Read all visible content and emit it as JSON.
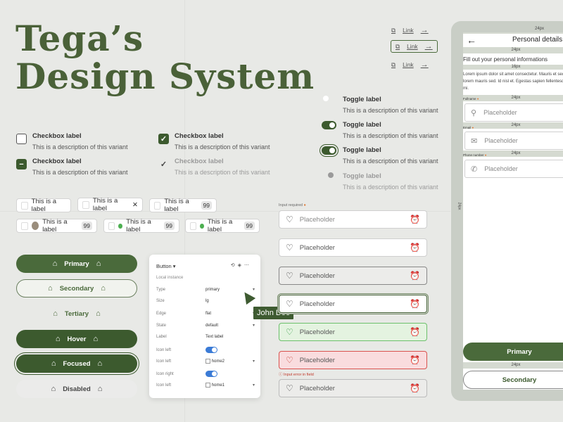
{
  "title": {
    "line1": "Tega’s",
    "line2": "Design System"
  },
  "checkboxes": [
    {
      "label": "Checkbox label",
      "desc": "This is a description of this variant",
      "state": "unchecked"
    },
    {
      "label": "Checkbox label",
      "desc": "This is a description of this variant",
      "state": "checked"
    },
    {
      "label": "Checkbox label",
      "desc": "This is a description of this variant",
      "state": "indeterminate"
    },
    {
      "label": "Checkbox label",
      "desc": "This is a description of this variant",
      "state": "disabled-check"
    }
  ],
  "chips": {
    "row1": [
      {
        "label": "This is a label"
      },
      {
        "label": "This is a label",
        "close": "✕"
      },
      {
        "label": "This is a label",
        "badge": "99"
      }
    ],
    "row2": [
      {
        "label": "This is a label",
        "badge": "99"
      },
      {
        "label": "This is a label",
        "badge": "99"
      },
      {
        "label": "This is a label",
        "badge": "99"
      }
    ]
  },
  "buttons": [
    {
      "label": "Primary",
      "variant": "primary"
    },
    {
      "label": "Secondary",
      "variant": "secondary"
    },
    {
      "label": "Tertiary",
      "variant": "tertiary"
    },
    {
      "label": "Hover",
      "variant": "hover"
    },
    {
      "label": "Focused",
      "variant": "focused"
    },
    {
      "label": "Disabled",
      "variant": "disabled"
    }
  ],
  "panel": {
    "title": "Button",
    "subtitle": "Local instance",
    "rows": [
      {
        "key": "Type",
        "value": "primary"
      },
      {
        "key": "Size",
        "value": "lg"
      },
      {
        "key": "Edge",
        "value": "flat"
      },
      {
        "key": "State",
        "value": "default"
      },
      {
        "key": "Label",
        "value": "Text label"
      },
      {
        "key": "Icon left",
        "value": ""
      },
      {
        "key": "Icon left",
        "value": "home2"
      },
      {
        "key": "Icon right",
        "value": ""
      },
      {
        "key": "Icon left",
        "value": "home1"
      }
    ]
  },
  "cursor_label": "John Doe",
  "toggles": [
    {
      "label": "Toggle label",
      "desc": "This is a description of this variant",
      "state": "off"
    },
    {
      "label": "Toggle label",
      "desc": "This is a description of this variant",
      "state": "on"
    },
    {
      "label": "Toggle label",
      "desc": "This is a description of this variant",
      "state": "focused"
    },
    {
      "label": "Toggle label",
      "desc": "This is a description of this variant",
      "state": "disabled"
    }
  ],
  "inputs": {
    "label": "Input required",
    "placeholder": "Placeholder",
    "error_hint": "Input error in field",
    "count": 7
  },
  "links": [
    {
      "label": "Link"
    },
    {
      "label": "Link"
    },
    {
      "label": "Link"
    }
  ],
  "phone": {
    "header": "Personal details",
    "intro": "Fill out your personal informations",
    "lorem": "Lorem ipsum dolor sit amet consectetur. Mauris et sed lorem mauris sed. Id nisl et. Egestas sapien fellentesque leo mi.",
    "field1_label": "Fullname",
    "field2_label": "Email",
    "field3_label": "Phone number",
    "placeholder": "Placeholder",
    "spacing": "24px",
    "spacing_small": "16px",
    "primary": "Primary",
    "secondary": "Secondary"
  },
  "colors": {
    "brand": "#4a6a3b",
    "brand_dark": "#3c5a2e",
    "bg": "#e8e9e6",
    "success": "#4caf50",
    "error": "#d9534f"
  }
}
